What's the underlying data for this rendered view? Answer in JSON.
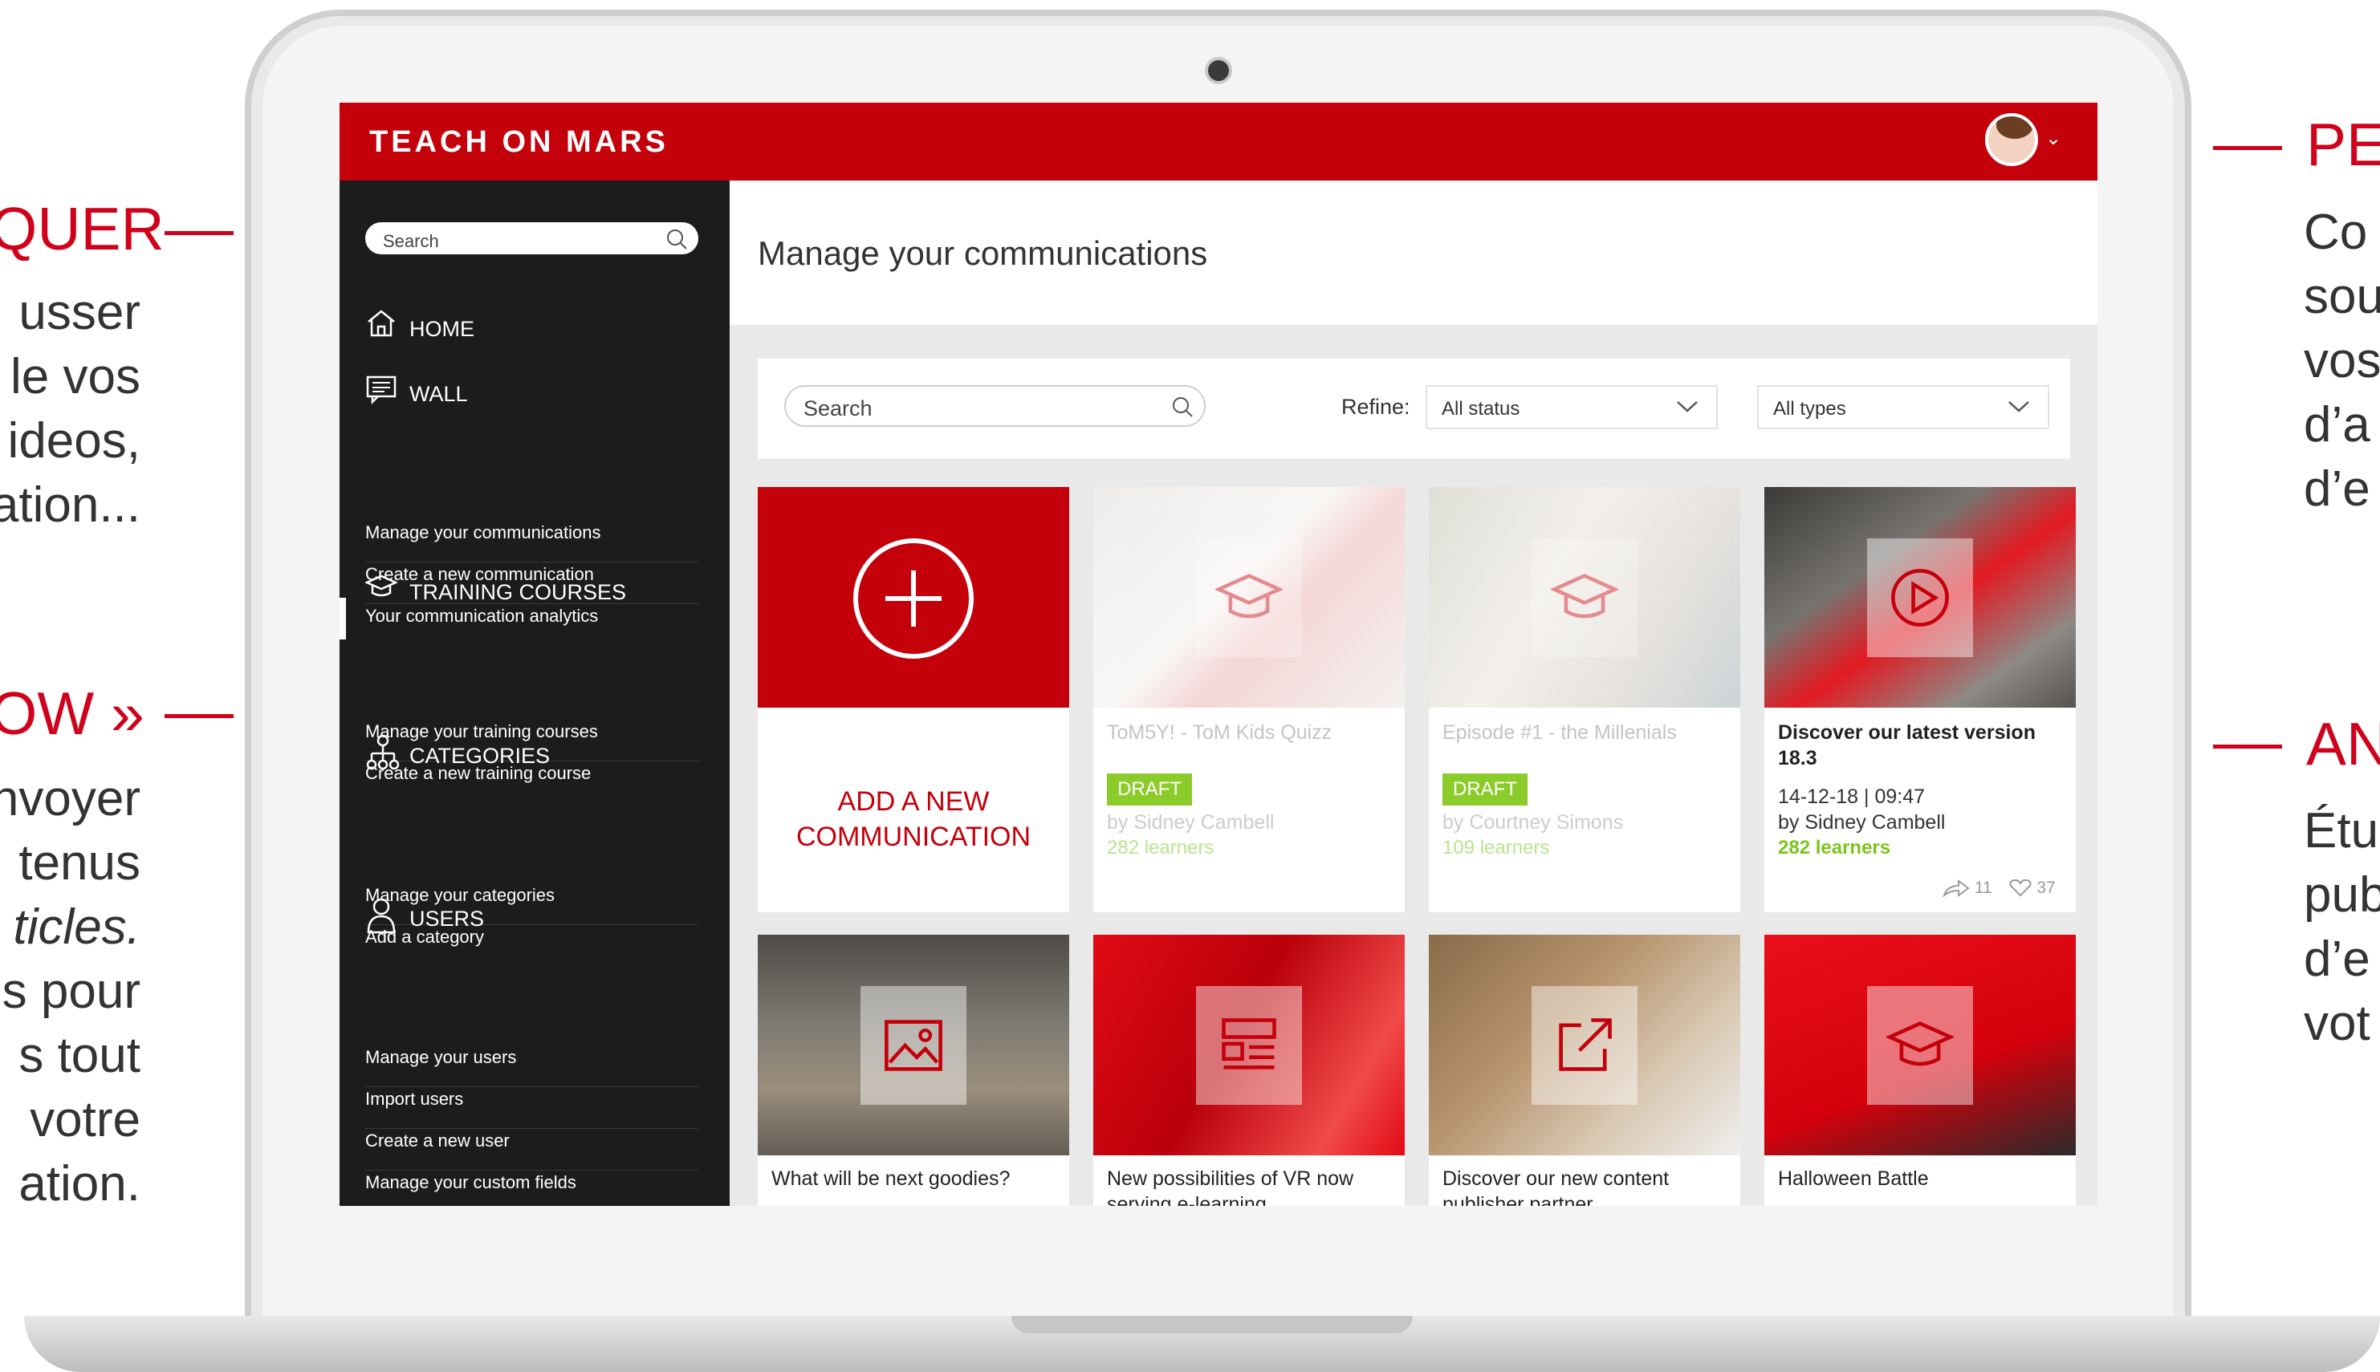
{
  "captions": {
    "left_top": {
      "heading": "QUER",
      "lines": [
        "usser",
        "le vos",
        "ideos,",
        "ation..."
      ]
    },
    "left_mid": {
      "heading": "OW »",
      "lines": [
        "nvoyer",
        "tenus",
        "ticles.",
        "s pour",
        "s tout",
        "votre",
        "ation."
      ]
    },
    "right_top": {
      "heading": "PE",
      "lines": [
        "Co",
        "sou",
        "vos",
        "d’a",
        "d’e"
      ]
    },
    "right_mid": {
      "heading": "AN",
      "lines": [
        "Étu",
        "pub",
        "d’e",
        "vot"
      ]
    }
  },
  "app": {
    "logo": "TEACH ON MARS",
    "brand_color": "#c4000b"
  },
  "sidebar": {
    "search_placeholder": "Search",
    "sections": [
      {
        "icon": "home-icon",
        "label": "HOME",
        "items": []
      },
      {
        "icon": "wall-icon",
        "label": "WALL",
        "items": [
          "Manage your communications",
          "Create a new communication",
          "Your communication analytics"
        ]
      },
      {
        "icon": "graduation-cap-icon",
        "label": "TRAINING COURSES",
        "items": [
          "Manage your training courses",
          "Create a new training course"
        ]
      },
      {
        "icon": "categories-icon",
        "label": "CATEGORIES",
        "items": [
          "Manage your categories",
          "Add a category"
        ]
      },
      {
        "icon": "user-icon",
        "label": "USERS",
        "items": [
          "Manage your users",
          "Import users",
          "Create a new user",
          "Manage your custom fields"
        ]
      }
    ]
  },
  "main": {
    "title": "Manage your communications",
    "filter": {
      "search_placeholder": "Search",
      "refine_label": "Refine:",
      "status_select": "All status",
      "type_select": "All types"
    },
    "add_card": {
      "label_line1": "ADD A NEW",
      "label_line2": "COMMUNICATION"
    },
    "cards": [
      {
        "title": "ToM5Y! - ToM Kids Quizz",
        "badge": "DRAFT",
        "author": "by Sidney Cambell",
        "learners": "282 learners",
        "icon": "graduation-cap-icon"
      },
      {
        "title": "Episode #1 - the Millenials",
        "badge": "DRAFT",
        "author": "by Courtney Simons",
        "learners": "109 learners",
        "icon": "graduation-cap-icon"
      },
      {
        "title": "Discover our latest version 18.3",
        "date": "14-12-18  |  09:47",
        "author": "by Sidney Cambell",
        "learners": "282 learners",
        "shares": "11",
        "likes": "37",
        "icon": "play-icon"
      }
    ],
    "bottom_cards": [
      {
        "title": "What will be next goodies?",
        "icon": "image-icon"
      },
      {
        "title": "New possibilities of VR now serving e-learning",
        "icon": "article-icon"
      },
      {
        "title": "Discover our new content publisher partner",
        "icon": "external-link-icon"
      },
      {
        "title": "Halloween Battle",
        "icon": "graduation-cap-icon"
      }
    ]
  }
}
